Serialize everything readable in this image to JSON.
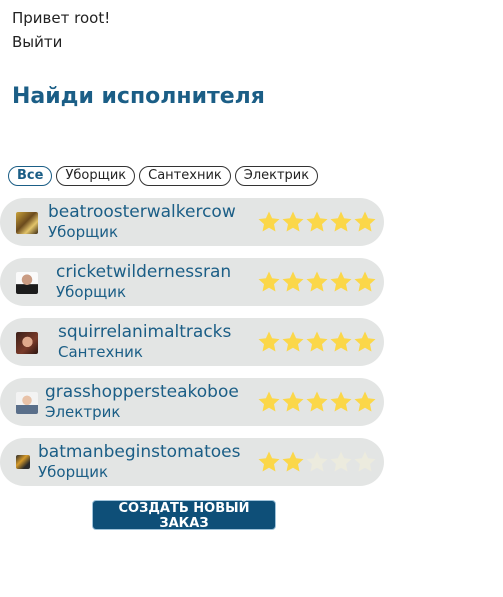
{
  "header": {
    "greeting": "Привет root!",
    "logout": "Выйти"
  },
  "title": "Найди исполнителя",
  "filters": [
    "Все",
    "Уборщик",
    "Сантехник",
    "Электрик"
  ],
  "active_filter": "Все",
  "workers": [
    {
      "name": "beatroosterwalkercow",
      "role": "Уборщик",
      "rating": 5
    },
    {
      "name": "cricketwildernessran",
      "role": "Уборщик",
      "rating": 5
    },
    {
      "name": "squirrelanimaltracks",
      "role": "Сантехник",
      "rating": 5
    },
    {
      "name": "grasshoppersteakoboe",
      "role": "Электрик",
      "rating": 5
    },
    {
      "name": "batmanbeginstomatoes",
      "role": "Уборщик",
      "rating": 2
    }
  ],
  "max_rating": 5,
  "create_button": "СОЗДАТЬ НОВЫЙ ЗАКАЗ",
  "colors": {
    "accent": "#1b5e86",
    "button": "#0e4f78",
    "star_on": "#fbd749",
    "star_off": "#ecebde",
    "row_bg": "#e3e5e4"
  }
}
